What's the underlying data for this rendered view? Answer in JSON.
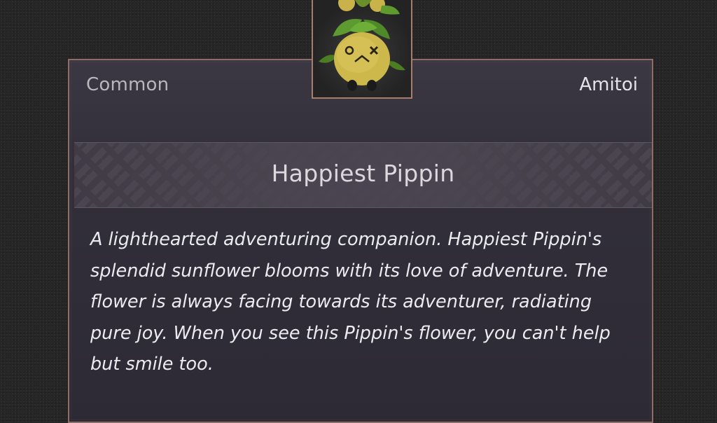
{
  "item": {
    "rarity": "Common",
    "category": "Amitoi",
    "name": "Happiest Pippin",
    "description": "A lighthearted adventuring companion. Happiest Pippin's splendid sunflower blooms with its love of adventure. The flower is always facing towards its adventurer, radiating pure joy. When you see this Pippin's flower, you can't help but smile too.",
    "portrait_icon": "pippin-amitoi-icon"
  },
  "colors": {
    "frame_border": "#8e6f66",
    "panel_bg": "#322f3a",
    "banner_bg": "#4a4550",
    "text_primary": "#ecebef"
  }
}
